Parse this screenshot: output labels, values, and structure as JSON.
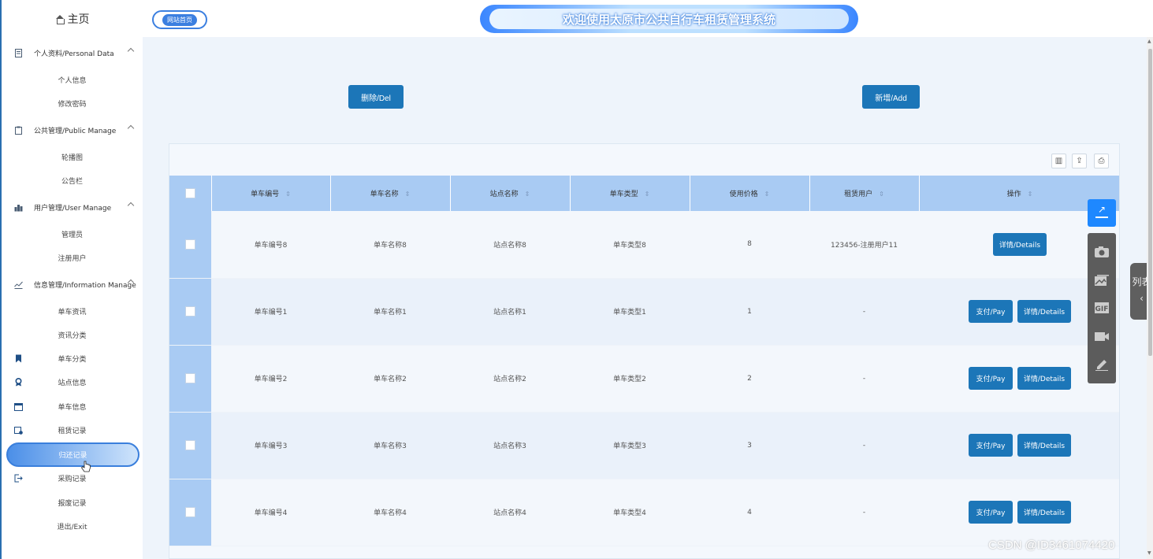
{
  "sidebar": {
    "home": "主页",
    "groups": [
      {
        "label": "个人资料/Personal Data",
        "items": [
          "个人信息",
          "修改密码"
        ]
      },
      {
        "label": "公共管理/Public Manage",
        "items": [
          "轮播图",
          "公告栏"
        ]
      },
      {
        "label": "用户管理/User Manage",
        "items": [
          "管理员",
          "注册用户"
        ]
      },
      {
        "label": "信息管理/Information Manage",
        "items": [
          "单车资讯",
          "资讯分类"
        ]
      }
    ],
    "flat": [
      "单车分类",
      "站点信息",
      "单车信息",
      "租赁记录",
      "归还记录",
      "采购记录",
      "报废记录",
      "退出/Exit"
    ],
    "active_item": "归还记录"
  },
  "topbar": {
    "home_badge": "网站首页",
    "title": "欢迎使用太原市公共自行车租赁管理系统"
  },
  "actions": {
    "delete": "删除/Del",
    "add": "新增/Add"
  },
  "table": {
    "headers": [
      "单车编号",
      "单车名称",
      "站点名称",
      "单车类型",
      "使用价格",
      "租赁用户",
      "操作"
    ],
    "rows": [
      {
        "code": "单车编号8",
        "name": "单车名称8",
        "station": "站点名称8",
        "type": "单车类型8",
        "price": "8",
        "user": "123456-注册用户11",
        "pay": false
      },
      {
        "code": "单车编号1",
        "name": "单车名称1",
        "station": "站点名称1",
        "type": "单车类型1",
        "price": "1",
        "user": "-",
        "pay": true
      },
      {
        "code": "单车编号2",
        "name": "单车名称2",
        "station": "站点名称2",
        "type": "单车类型2",
        "price": "2",
        "user": "-",
        "pay": true
      },
      {
        "code": "单车编号3",
        "name": "单车名称3",
        "station": "站点名称3",
        "type": "单车类型3",
        "price": "3",
        "user": "-",
        "pay": true
      },
      {
        "code": "单车编号4",
        "name": "单车名称4",
        "station": "站点名称4",
        "type": "单车类型4",
        "price": "4",
        "user": "-",
        "pay": true
      }
    ],
    "pay_label": "支付/Pay",
    "details_label": "详情/Details"
  },
  "side_tab": {
    "label": "列表"
  },
  "toolbar_icons": [
    "share-icon",
    "camera-icon",
    "image-icon",
    "gif-icon",
    "video-icon",
    "pen-icon"
  ],
  "watermark": "CSDN @ID3461074420",
  "colors": {
    "primary_button": "#1c76b8",
    "table_header": "#a9cbf3",
    "accent": "#3a7fdc"
  }
}
